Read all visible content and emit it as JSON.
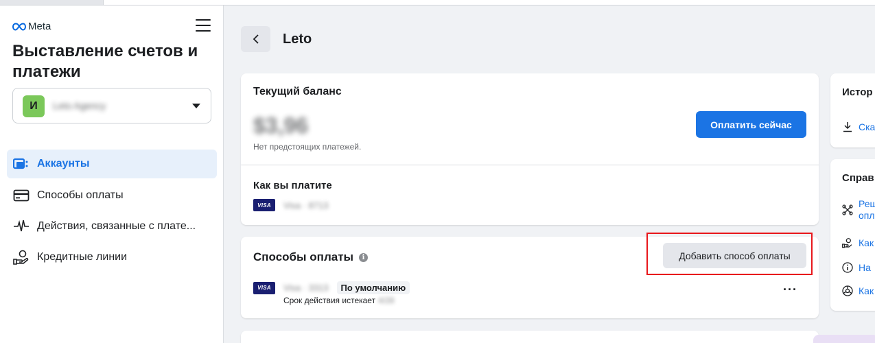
{
  "sidebar": {
    "brand": "Meta",
    "title": "Выставление счетов и платежи",
    "account": {
      "avatar_letter": "И",
      "name": "Leto Agency"
    },
    "nav": [
      {
        "label": "Аккаунты",
        "icon": "accounts-icon",
        "active": true
      },
      {
        "label": "Способы оплаты",
        "icon": "credit-card-icon",
        "active": false
      },
      {
        "label": "Действия, связанные с плате...",
        "icon": "activity-icon",
        "active": false
      },
      {
        "label": "Кредитные линии",
        "icon": "credit-line-icon",
        "active": false
      }
    ]
  },
  "header": {
    "back_icon": "chevron-left-icon",
    "title": "Leto"
  },
  "balance_card": {
    "title": "Текущий баланс",
    "amount": "$3,96",
    "note": "Нет предстоящих платежей.",
    "pay_button": "Оплатить сейчас",
    "how_title": "Как вы платите",
    "card_brand": "VISA",
    "card_masked": "Visa · 8713"
  },
  "methods_card": {
    "title": "Способы оплаты",
    "info_glyph": "i",
    "add_button": "Добавить способ оплаты",
    "card_brand": "VISA",
    "card_masked": "Visa · 3313",
    "default_badge": "По умолчанию",
    "expiry_label": "Срок действия истекает",
    "expiry_value": "4/28",
    "more": "···"
  },
  "right_panel": {
    "history_title": "Истор",
    "history_link": "Ска",
    "help_title": "Справ",
    "help_links": [
      {
        "line1": "Реш",
        "line2": "опл",
        "icon": "puzzle-icon"
      },
      {
        "line1": "Как",
        "line2": "",
        "icon": "credit-line-icon"
      },
      {
        "line1": "На",
        "line2": "",
        "icon": "info-icon"
      },
      {
        "line1": "Как",
        "line2": "",
        "icon": "settings-wheel-icon"
      }
    ]
  },
  "colors": {
    "accent": "#1b74e4",
    "highlight": "#e8161b",
    "visa": "#1a1f71",
    "avatar": "#7bc85a"
  }
}
